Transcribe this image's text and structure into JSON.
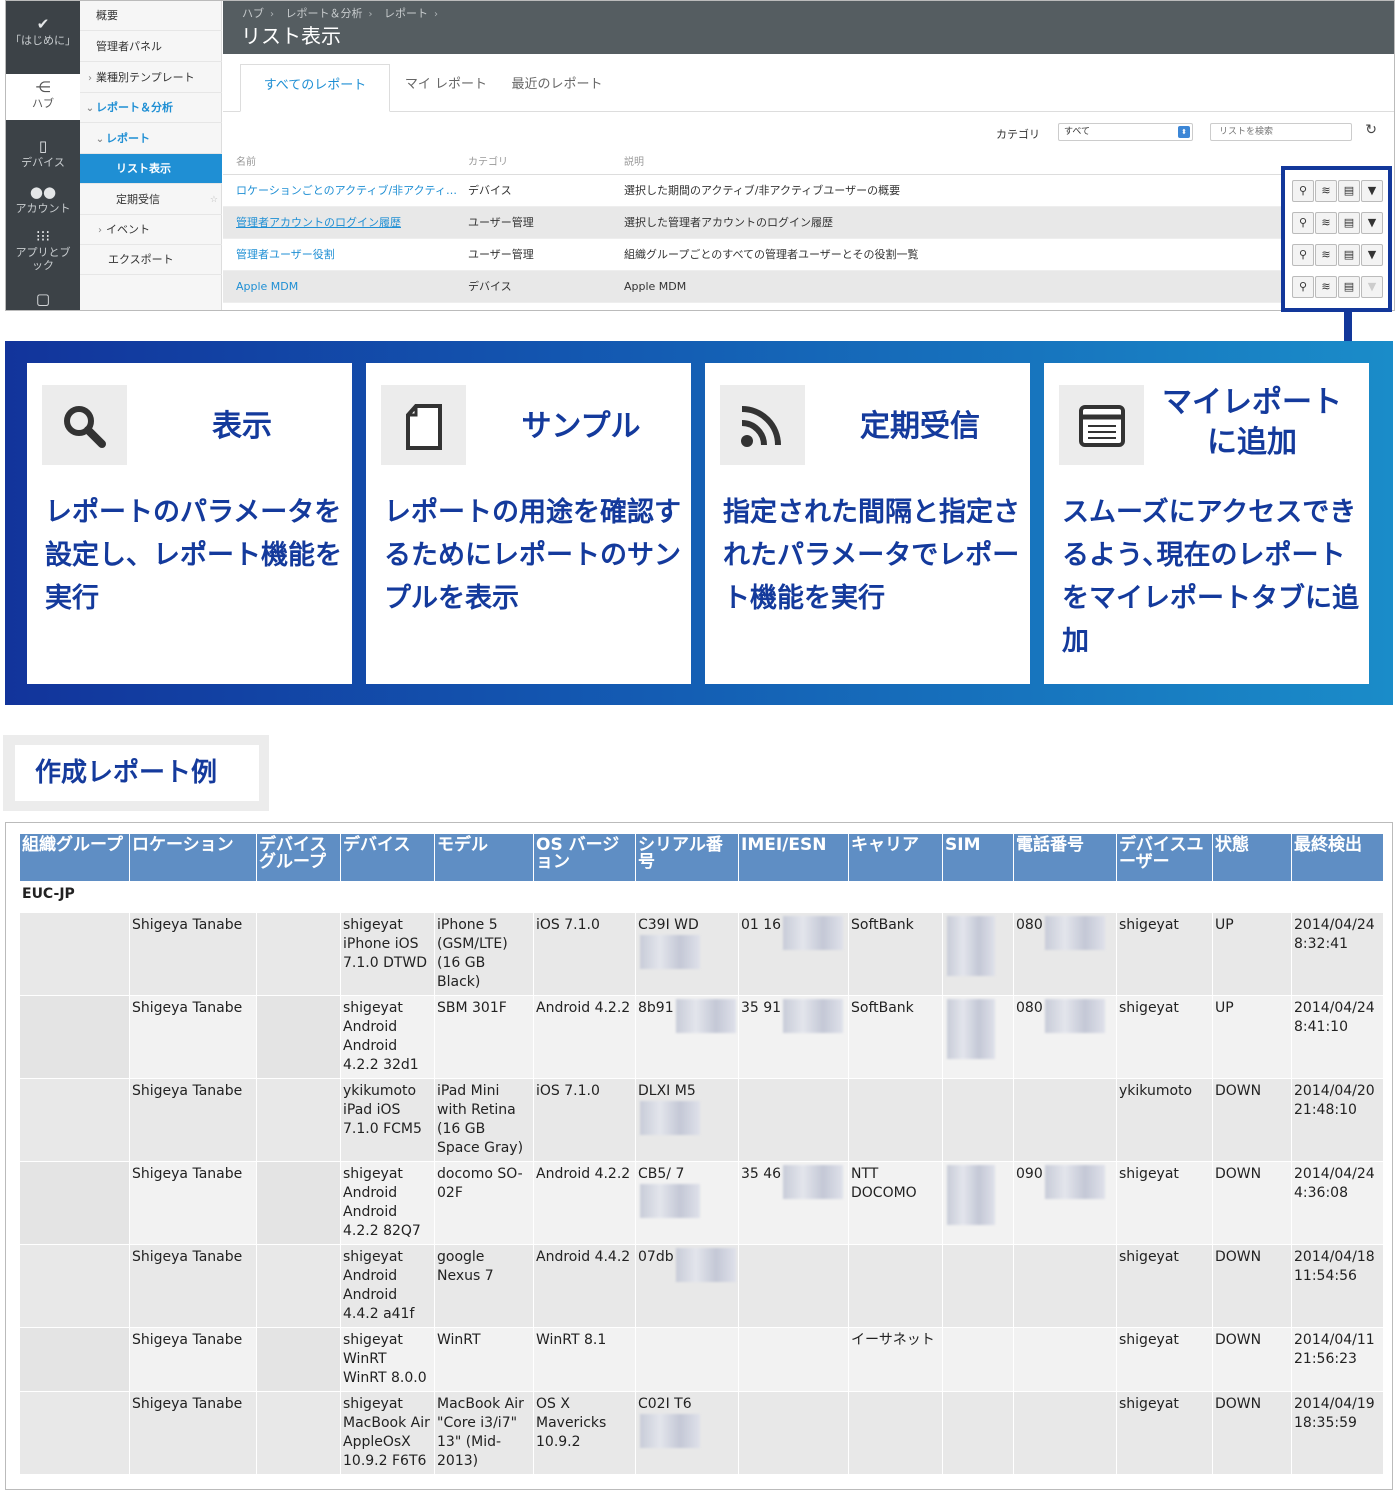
{
  "iconbar": [
    {
      "icon": "check-icon",
      "label": "「はじめに」"
    },
    {
      "icon": "hub-icon",
      "label": "ハブ"
    },
    {
      "icon": "device-icon",
      "label": "デバイス"
    },
    {
      "icon": "account-icon",
      "label": "アカウント"
    },
    {
      "icon": "apps-grid-icon",
      "label": "アプリとブック"
    },
    {
      "icon": "document-icon",
      "label": ""
    }
  ],
  "sidenav": {
    "overview": "概要",
    "admin_panel": "管理者パネル",
    "templates": "業種別テンプレート",
    "reports_analytics": "レポート＆分析",
    "reports": "レポート",
    "list_view": "リスト表示",
    "scheduled": "定期受信",
    "events": "イベント",
    "export": "エクスポート"
  },
  "breadcrumb": [
    "ハブ",
    "レポート＆分析",
    "レポート"
  ],
  "page_title": "リスト表示",
  "tabs": [
    "すべてのレポート",
    "マイ レポート",
    "最近のレポート"
  ],
  "filter": {
    "category_label": "カテゴリ",
    "category_value": "すべて",
    "search_placeholder": "リストを検索"
  },
  "report_list": {
    "headers": [
      "名前",
      "カテゴリ",
      "説明"
    ],
    "rows": [
      {
        "name": "ロケーションごとのアクティブ/非アクティ…",
        "category": "デバイス",
        "description": "選択した期間のアクティブ/非アクティブユーザーの概要"
      },
      {
        "name": "管理者アカウントのログイン履歴",
        "category": "ユーザー管理",
        "description": "選択した管理者アカウントのログイン履歴"
      },
      {
        "name": "管理者ユーザー役割",
        "category": "ユーザー管理",
        "description": "組織グループごとのすべての管理者ユーザーとその役割一覧"
      },
      {
        "name": "Apple MDM",
        "category": "デバイス",
        "description": "Apple MDM"
      }
    ]
  },
  "features": [
    {
      "icon": "search-icon",
      "title": "表示",
      "desc": "レポートのパラメータを設定し、レポート機能を実行"
    },
    {
      "icon": "sample-document-icon",
      "title": "サンプル",
      "desc": "レポートの用途を確認するためにレポートのサンプルを表示"
    },
    {
      "icon": "rss-icon",
      "title": "定期受信",
      "desc": "指定された間隔と指定されたパラメータでレポート機能を実行"
    },
    {
      "icon": "list-icon",
      "title": "マイレポートに追加",
      "desc": "スムーズにアクセスできるよう､現在のレポートをマイレポートタブに追加"
    }
  ],
  "example_label": "作成レポート例",
  "report": {
    "headers": [
      "組織グループ",
      "ロケーション",
      "デバイスグループ",
      "デバイス",
      "モデル",
      "OS バージョン",
      "シリアル番号",
      "IMEI/ESN",
      "キャリア",
      "SIM",
      "電話番号",
      "デバイスユーザー",
      "状態",
      "最終検出"
    ],
    "group_name": "EUC-JP",
    "rows": [
      {
        "location": "Shigeya Tanabe",
        "device": "shigeyat iPhone iOS 7.1.0 DTWD",
        "model": "iPhone 5 (GSM/LTE) (16 GB Black)",
        "os": "iOS 7.1.0",
        "serial": "C39I WD",
        "imei": "01 16",
        "carrier": "SoftBank",
        "phone": "080",
        "user": "shigeyat",
        "status": "UP",
        "last_seen": "2014/04/24 8:32:41"
      },
      {
        "location": "Shigeya Tanabe",
        "device": "shigeyat Android Android 4.2.2 32d1",
        "model": "SBM 301F",
        "os": "Android 4.2.2",
        "serial": "8b91",
        "imei": "35 91",
        "carrier": "SoftBank",
        "phone": "080",
        "user": "shigeyat",
        "status": "UP",
        "last_seen": "2014/04/24 8:41:10"
      },
      {
        "location": "Shigeya Tanabe",
        "device": "ykikumoto iPad iOS 7.1.0 FCM5",
        "model": "iPad Mini with Retina (16 GB Space Gray)",
        "os": "iOS 7.1.0",
        "serial": "DLXI M5",
        "imei": "",
        "carrier": "",
        "phone": "",
        "user": "ykikumoto",
        "status": "DOWN",
        "last_seen": "2014/04/20 21:48:10"
      },
      {
        "location": "Shigeya Tanabe",
        "device": "shigeyat Android Android 4.2.2 82Q7",
        "model": "docomo SO-02F",
        "os": "Android 4.2.2",
        "serial": "CB5/ 7",
        "imei": "35 46",
        "carrier": "NTT DOCOMO",
        "phone": "090",
        "user": "shigeyat",
        "status": "DOWN",
        "last_seen": "2014/04/24 4:36:08"
      },
      {
        "location": "Shigeya Tanabe",
        "device": "shigeyat Android Android 4.4.2 a41f",
        "model": "google Nexus 7",
        "os": "Android 4.4.2",
        "serial": "07db",
        "imei": "",
        "carrier": "",
        "phone": "",
        "user": "shigeyat",
        "status": "DOWN",
        "last_seen": "2014/04/18 11:54:56"
      },
      {
        "location": "Shigeya Tanabe",
        "device": "shigeyat WinRT WinRT 8.0.0",
        "model": "WinRT",
        "os": "WinRT 8.1",
        "serial": "",
        "imei": "",
        "carrier": "イーサネット",
        "phone": "",
        "user": "shigeyat",
        "status": "DOWN",
        "last_seen": "2014/04/11 21:56:23"
      },
      {
        "location": "Shigeya Tanabe",
        "device": "shigeyat MacBook Air AppleOsX 10.9.2 F6T6",
        "model": "MacBook Air \"Core i3/i7\" 13\" (Mid-2013)",
        "os": "OS X Mavericks 10.9.2",
        "serial": "C02I T6",
        "imei": "",
        "carrier": "",
        "phone": "",
        "user": "shigeyat",
        "status": "DOWN",
        "last_seen": "2014/04/19 18:35:59"
      }
    ]
  },
  "colors": {
    "accent_blue": "#1f8fd4",
    "panel_dark": "#12349b",
    "panel_light": "#1a8cc9",
    "header_gray": "#555d61",
    "table_header": "#5f8ec4"
  }
}
